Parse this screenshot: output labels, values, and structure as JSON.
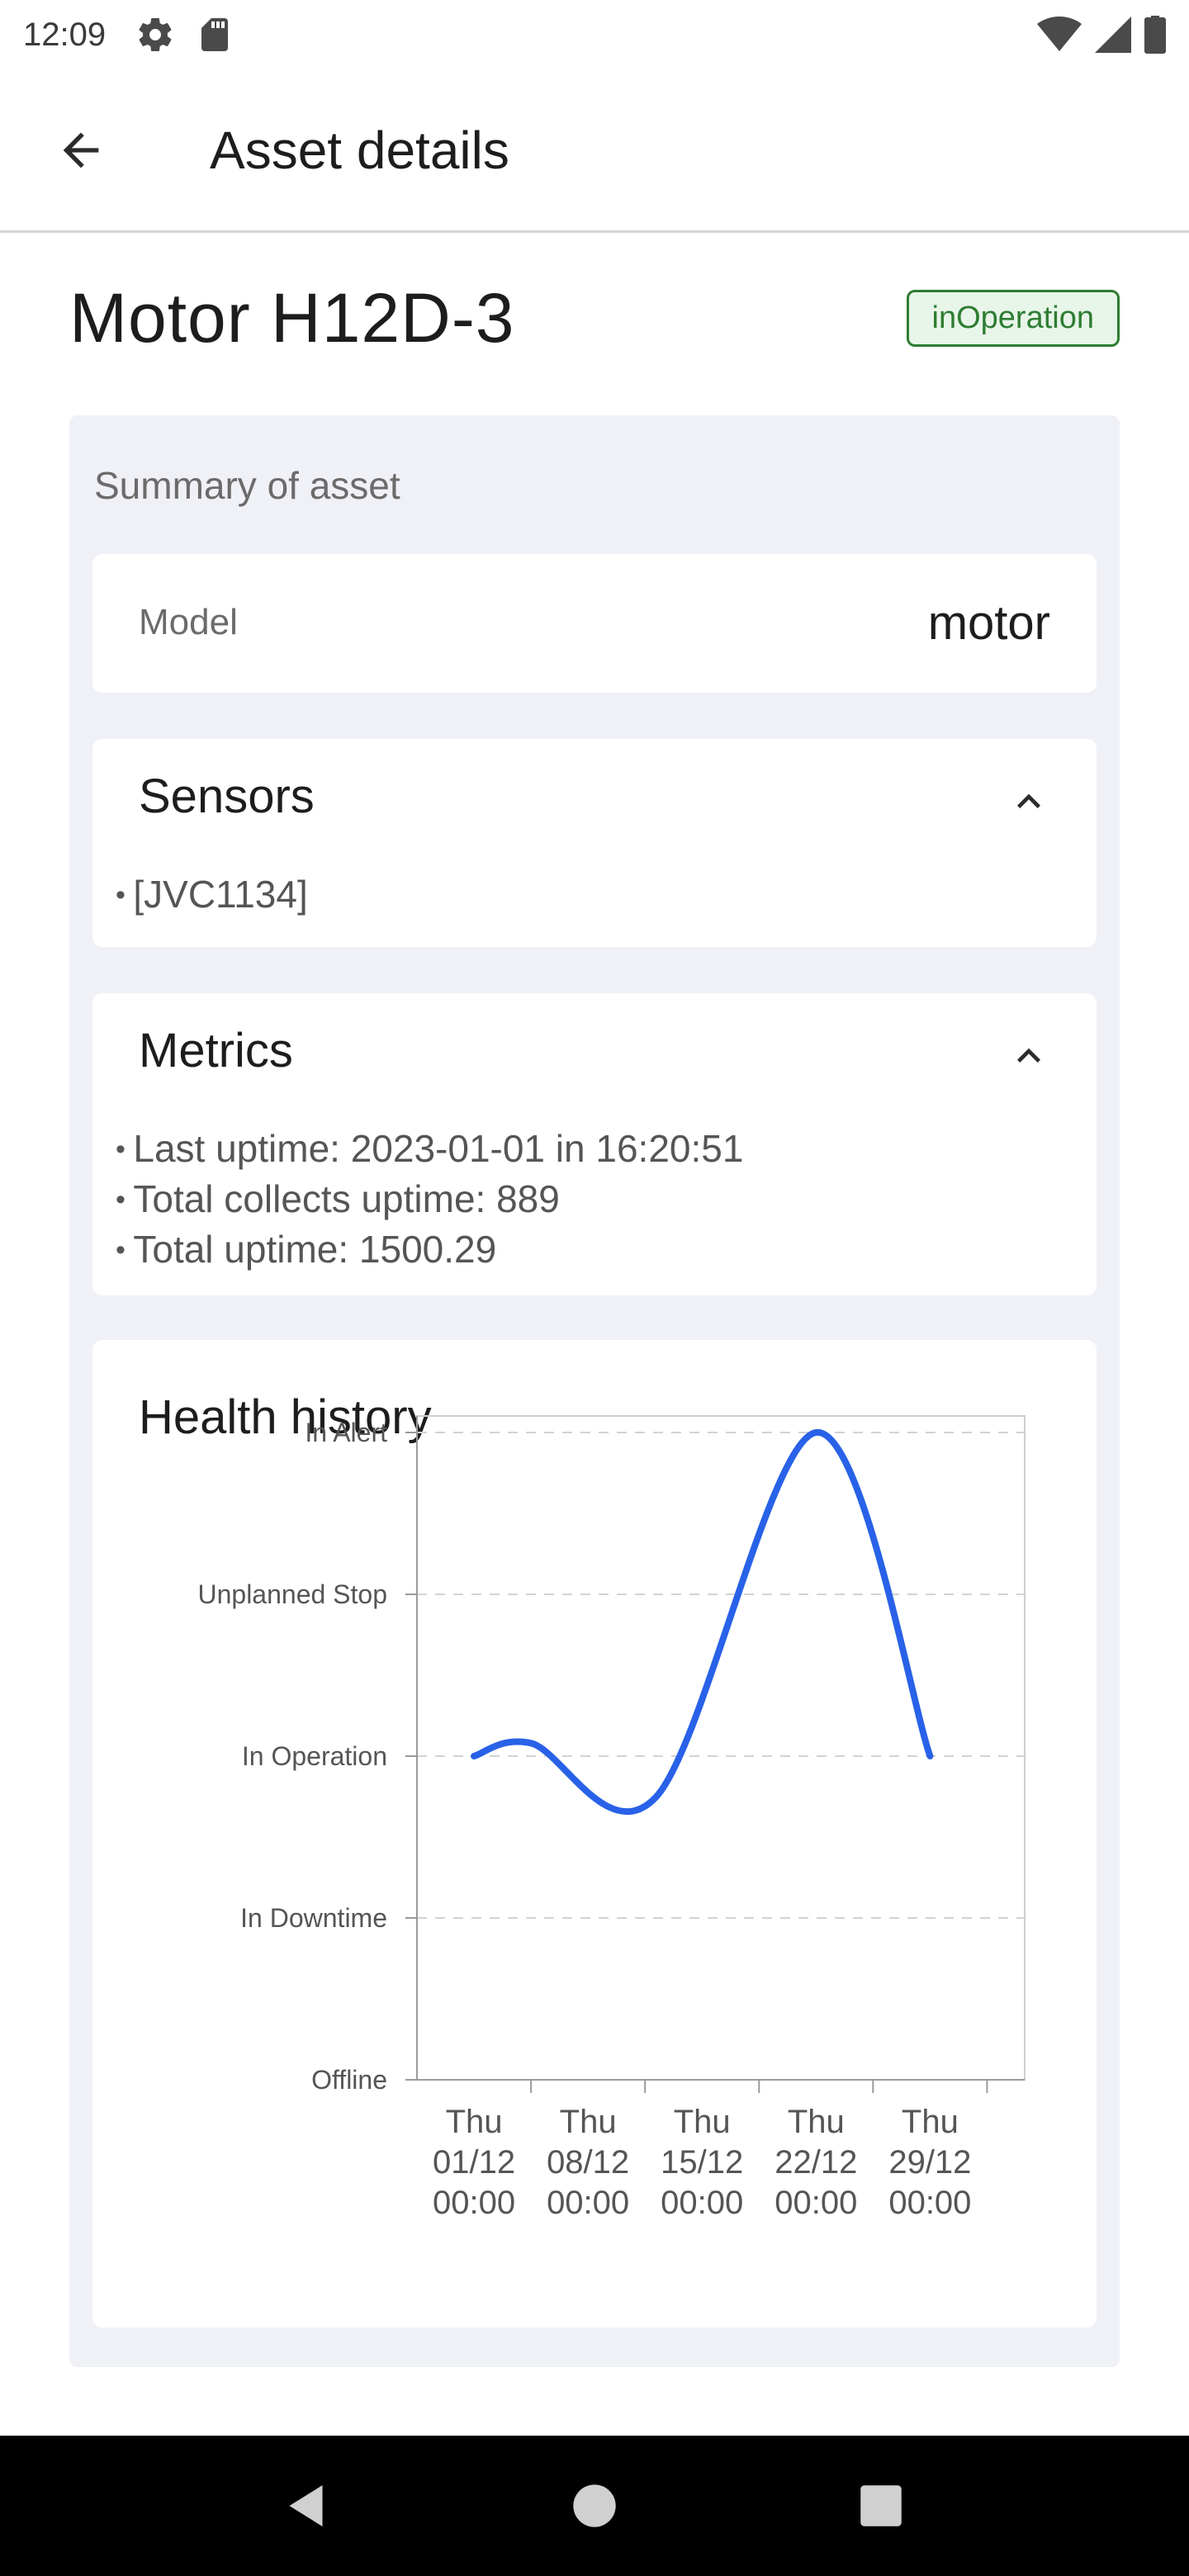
{
  "status_bar": {
    "time": "12:09",
    "left_icons": [
      "gear-icon",
      "sd-card-icon"
    ],
    "right_icons": [
      "wifi-icon",
      "cellular-icon",
      "battery-icon"
    ]
  },
  "app_bar": {
    "title": "Asset details",
    "back_icon": "arrow-back-icon"
  },
  "asset": {
    "name": "Motor H12D-3",
    "status": "inOperation",
    "status_color": "#2e7d32"
  },
  "summary": {
    "title": "Summary of asset",
    "model": {
      "label": "Model",
      "value": "motor"
    },
    "sensors": {
      "heading": "Sensors",
      "items": [
        "[JVC1134]"
      ]
    },
    "metrics": {
      "heading": "Metrics",
      "items": [
        "Last uptime: 2023-01-01 in 16:20:51",
        "Total collects uptime: 889",
        "Total uptime: 1500.29"
      ]
    }
  },
  "chart_data": {
    "type": "line",
    "title": "Health history",
    "y_categories": [
      "Offline",
      "In Downtime",
      "In Operation",
      "Unplanned Stop",
      "In Alert"
    ],
    "x_ticks": [
      [
        "Thu",
        "01/12",
        "00:00"
      ],
      [
        "Thu",
        "08/12",
        "00:00"
      ],
      [
        "Thu",
        "15/12",
        "00:00"
      ],
      [
        "Thu",
        "22/12",
        "00:00"
      ],
      [
        "Thu",
        "29/12",
        "00:00"
      ]
    ],
    "x_range": [
      0,
      5.33
    ],
    "ylim": [
      0,
      4
    ],
    "grid": true,
    "line_color": "#2962e8",
    "points": [
      {
        "x": 0.5,
        "y": 2
      },
      {
        "x": 1.0,
        "y": 2.08
      },
      {
        "x": 2.1,
        "y": 1.75
      },
      {
        "x": 3.5,
        "y": 4
      },
      {
        "x": 4.5,
        "y": 2
      }
    ]
  },
  "nav_bar": {
    "icons": [
      "back-triangle-icon",
      "home-circle-icon",
      "recents-square-icon"
    ]
  }
}
